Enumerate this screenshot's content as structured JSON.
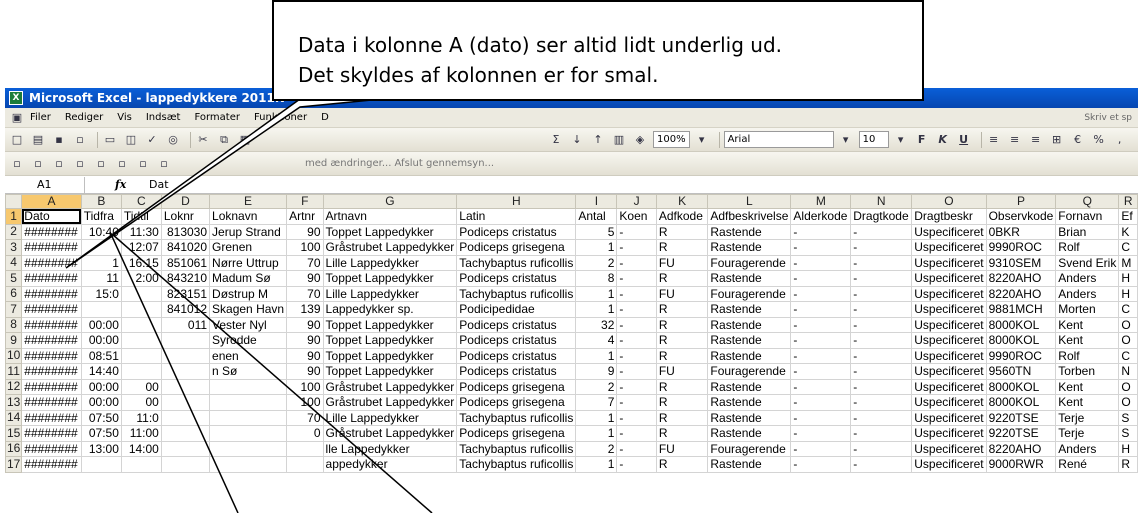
{
  "callout": {
    "line1": "Data i kolonne A (dato) ser altid lidt underlig ud.",
    "line2": "Det skyldes af kolonnen er for smal."
  },
  "window": {
    "title": "Microsoft Excel - lappedykkere 2011N"
  },
  "menu": {
    "items": [
      "Filer",
      "Rediger",
      "Vis",
      "Indsæt",
      "Formater",
      "Funktioner",
      "D"
    ],
    "help_placeholder": "Skriv et sp"
  },
  "toolbar1": {
    "zoom": "100%",
    "font": "Arial",
    "size": "10"
  },
  "toolbar2": {
    "review_text": "med ændringer... Afslut gennemsyn..."
  },
  "formula": {
    "namebox": "A1",
    "fx": "fx",
    "value": "Dat"
  },
  "columns": [
    "A",
    "B",
    "C",
    "D",
    "E",
    "F",
    "G",
    "H",
    "I",
    "J",
    "K",
    "L",
    "M",
    "N",
    "O",
    "P",
    "Q",
    "R"
  ],
  "rows": [
    [
      "Dato",
      "Tidfra",
      "Tidtil",
      "Loknr",
      "Loknavn",
      "Artnr",
      "Artnavn",
      "Latin",
      "Antal",
      "Koen",
      "Adfkode",
      "Adfbeskrivelse",
      "Alderkode",
      "Dragtkode",
      "Dragtbeskr",
      "Observkode",
      "Fornavn",
      "Ef"
    ],
    [
      "########",
      "10:40",
      "11:30",
      "813030",
      "Jerup Strand",
      "90",
      "Toppet Lappedykker",
      "Podiceps cristatus",
      "5",
      "-",
      "R",
      "Rastende",
      "-",
      "-",
      "Uspecificeret",
      "0BKR",
      "Brian",
      "K"
    ],
    [
      "########",
      "",
      "12:07",
      "841020",
      "Grenen",
      "100",
      "Gråstrubet Lappedykker",
      "Podiceps grisegena",
      "1",
      "-",
      "R",
      "Rastende",
      "-",
      "-",
      "Uspecificeret",
      "9990ROC",
      "Rolf",
      "C"
    ],
    [
      "########",
      "1",
      "16:15",
      "851061",
      "Nørre Uttrup",
      "70",
      "Lille Lappedykker",
      "Tachybaptus ruficollis",
      "2",
      "-",
      "FU",
      "Fouragerende",
      "-",
      "-",
      "Uspecificeret",
      "9310SEM",
      "Svend Erik",
      "M"
    ],
    [
      "########",
      "11",
      "2:00",
      "843210",
      "Madum Sø",
      "90",
      "Toppet Lappedykker",
      "Podiceps cristatus",
      "8",
      "-",
      "R",
      "Rastende",
      "-",
      "-",
      "Uspecificeret",
      "8220AHO",
      "Anders",
      "H"
    ],
    [
      "########",
      "15:0",
      "",
      "823151",
      "Døstrup M",
      "70",
      "Lille Lappedykker",
      "Tachybaptus ruficollis",
      "1",
      "-",
      "FU",
      "Fouragerende",
      "-",
      "-",
      "Uspecificeret",
      "8220AHO",
      "Anders",
      "H"
    ],
    [
      "########",
      "",
      "",
      "841012",
      "Skagen Havn",
      "139",
      "Lappedykker sp.",
      "Podicipedidae",
      "1",
      "-",
      "R",
      "Rastende",
      "-",
      "-",
      "Uspecificeret",
      "9881MCH",
      "Morten",
      "C"
    ],
    [
      "########",
      "00:00",
      "",
      "011",
      "Vester Nyl",
      "90",
      "Toppet Lappedykker",
      "Podiceps cristatus",
      "32",
      "-",
      "R",
      "Rastende",
      "-",
      "-",
      "Uspecificeret",
      "8000KOL",
      "Kent",
      "O"
    ],
    [
      "########",
      "00:00",
      "",
      "",
      "Syrodde",
      "90",
      "Toppet Lappedykker",
      "Podiceps cristatus",
      "4",
      "-",
      "R",
      "Rastende",
      "-",
      "-",
      "Uspecificeret",
      "8000KOL",
      "Kent",
      "O"
    ],
    [
      "########",
      "08:51",
      "",
      "",
      "enen",
      "90",
      "Toppet Lappedykker",
      "Podiceps cristatus",
      "1",
      "-",
      "R",
      "Rastende",
      "-",
      "-",
      "Uspecificeret",
      "9990ROC",
      "Rolf",
      "C"
    ],
    [
      "########",
      "14:40",
      "",
      "",
      "n Sø",
      "90",
      "Toppet Lappedykker",
      "Podiceps cristatus",
      "9",
      "-",
      "FU",
      "Fouragerende",
      "-",
      "-",
      "Uspecificeret",
      "9560TN",
      "Torben",
      "N"
    ],
    [
      "########",
      "00:00",
      "00",
      "",
      "",
      "100",
      "Gråstrubet Lappedykker",
      "Podiceps grisegena",
      "2",
      "-",
      "R",
      "Rastende",
      "-",
      "-",
      "Uspecificeret",
      "8000KOL",
      "Kent",
      "O"
    ],
    [
      "########",
      "00:00",
      "00",
      "",
      "",
      "100",
      "Gråstrubet Lappedykker",
      "Podiceps grisegena",
      "7",
      "-",
      "R",
      "Rastende",
      "-",
      "-",
      "Uspecificeret",
      "8000KOL",
      "Kent",
      "O"
    ],
    [
      "########",
      "07:50",
      "11:0",
      "",
      "",
      "70",
      "Lille Lappedykker",
      "Tachybaptus ruficollis",
      "1",
      "-",
      "R",
      "Rastende",
      "-",
      "-",
      "Uspecificeret",
      "9220TSE",
      "Terje",
      "S"
    ],
    [
      "########",
      "07:50",
      "11:00",
      "",
      "",
      "0",
      "Gråstrubet Lappedykker",
      "Podiceps grisegena",
      "1",
      "-",
      "R",
      "Rastende",
      "-",
      "-",
      "Uspecificeret",
      "9220TSE",
      "Terje",
      "S"
    ],
    [
      "########",
      "13:00",
      "14:00",
      "",
      "",
      "",
      "lle Lappedykker",
      "Tachybaptus ruficollis",
      "2",
      "-",
      "FU",
      "Fouragerende",
      "-",
      "-",
      "Uspecificeret",
      "8220AHO",
      "Anders",
      "H"
    ],
    [
      "########",
      "",
      "",
      "",
      "",
      "",
      "appedykker",
      "Tachybaptus ruficollis",
      "1",
      "-",
      "R",
      "Rastende",
      "-",
      "-",
      "Uspecificeret",
      "9000RWR",
      "René",
      "R"
    ]
  ]
}
